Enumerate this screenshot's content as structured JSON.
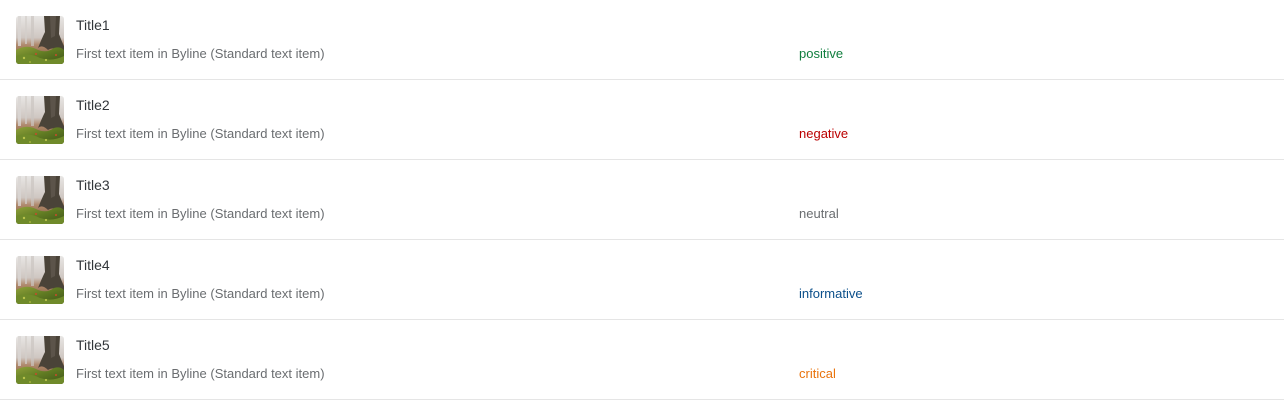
{
  "list": {
    "items": [
      {
        "title": "Title1",
        "byline": "First text item in Byline (Standard text item)",
        "status": "positive",
        "status_color": "#107e3e",
        "thumbnail": "forest-tree-thumbnail"
      },
      {
        "title": "Title2",
        "byline": "First text item in Byline (Standard text item)",
        "status": "negative",
        "status_color": "#bb0000",
        "thumbnail": "forest-tree-thumbnail"
      },
      {
        "title": "Title3",
        "byline": "First text item in Byline (Standard text item)",
        "status": "neutral",
        "status_color": "#6a6d70",
        "thumbnail": "forest-tree-thumbnail"
      },
      {
        "title": "Title4",
        "byline": "First text item in Byline (Standard text item)",
        "status": "informative",
        "status_color": "#0b4f8a",
        "thumbnail": "forest-tree-thumbnail"
      },
      {
        "title": "Title5",
        "byline": "First text item in Byline (Standard text item)",
        "status": "critical",
        "status_color": "#e9730c",
        "thumbnail": "forest-tree-thumbnail"
      }
    ]
  }
}
